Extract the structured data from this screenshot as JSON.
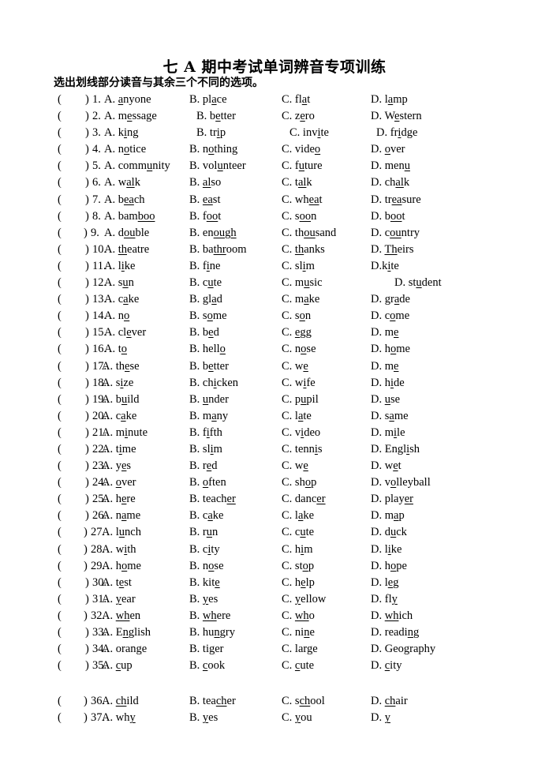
{
  "document": {
    "title": "七 A 期中考试单词辨音专项训练",
    "instruction": "选出划线部分读音与其余三个不同的选项。",
    "bracket_open": "(",
    "bracket_close": ")"
  },
  "questions": [
    {
      "num": "1.",
      "opts": [
        {
          "label": "A.",
          "pre": "",
          "u": "a",
          "post": "nyone"
        },
        {
          "label": "B.",
          "pre": "pl",
          "u": "a",
          "post": "ce"
        },
        {
          "label": "C.",
          "pre": "fl",
          "u": "a",
          "post": "t"
        },
        {
          "label": "D.",
          "pre": "l",
          "u": "a",
          "post": "mp"
        }
      ]
    },
    {
      "num": "2.",
      "indentB": true,
      "opts": [
        {
          "label": "A.",
          "pre": "m",
          "u": "e",
          "post": "ssage"
        },
        {
          "label": "B.",
          "pre": "b",
          "u": "e",
          "post": "tter"
        },
        {
          "label": "C.",
          "pre": "z",
          "u": "e",
          "post": "ro"
        },
        {
          "label": "D.",
          "pre": "W",
          "u": "e",
          "post": "stern"
        }
      ]
    },
    {
      "num": "3.",
      "indentB": true,
      "indentC": true,
      "indentD": true,
      "opts": [
        {
          "label": "A.",
          "pre": "k",
          "u": "i",
          "post": "ng"
        },
        {
          "label": "B.",
          "pre": "tr",
          "u": "i",
          "post": "p"
        },
        {
          "label": "C.",
          "pre": "inv",
          "u": "i",
          "post": "te"
        },
        {
          "label": "D.",
          "pre": "fr",
          "u": "i",
          "post": "dge"
        }
      ]
    },
    {
      "num": "4.",
      "opts": [
        {
          "label": "A.",
          "pre": "n",
          "u": "o",
          "post": "tice"
        },
        {
          "label": "B.",
          "pre": "n",
          "u": "o",
          "post": "thing"
        },
        {
          "label": "C.",
          "pre": "vide",
          "u": "o",
          "post": ""
        },
        {
          "label": "D.",
          "pre": "",
          "u": "o",
          "post": "ver"
        }
      ]
    },
    {
      "num": "5.",
      "opts": [
        {
          "label": "A.",
          "pre": "comm",
          "u": "u",
          "post": "nity"
        },
        {
          "label": "B.",
          "pre": "vol",
          "u": "u",
          "post": "nteer"
        },
        {
          "label": "C.",
          "pre": "f",
          "u": "u",
          "post": "ture"
        },
        {
          "label": "D.",
          "pre": "men",
          "u": "u",
          "post": ""
        }
      ]
    },
    {
      "num": "6.",
      "opts": [
        {
          "label": "A.",
          "pre": "w",
          "u": "al",
          "post": "k"
        },
        {
          "label": "B.",
          "pre": "",
          "u": "al",
          "post": "so"
        },
        {
          "label": "C.",
          "pre": "t",
          "u": "al",
          "post": "k"
        },
        {
          "label": "D.",
          "pre": "ch",
          "u": "al",
          "post": "k"
        }
      ]
    },
    {
      "num": "7.",
      "opts": [
        {
          "label": "A.",
          "pre": "b",
          "u": "ea",
          "post": "ch"
        },
        {
          "label": "B.",
          "pre": "",
          "u": "ea",
          "post": "st"
        },
        {
          "label": "C.",
          "pre": "wh",
          "u": "ea",
          "post": "t"
        },
        {
          "label": "D.",
          "pre": "tr",
          "u": "ea",
          "post": "sure"
        }
      ]
    },
    {
      "num": "8.",
      "opts": [
        {
          "label": "A.",
          "pre": "bam",
          "u": "boo",
          "post": ""
        },
        {
          "label": "B.",
          "pre": "f",
          "u": "oo",
          "post": "t"
        },
        {
          "label": "C.",
          "pre": "s",
          "u": "oo",
          "post": "n"
        },
        {
          "label": "D.",
          "pre": "b",
          "u": "oo",
          "post": "t"
        }
      ]
    },
    {
      "num": "9.",
      "tightNum": true,
      "opts": [
        {
          "label": "A.",
          "pre": "d",
          "u": "ou",
          "post": "ble"
        },
        {
          "label": "B.",
          "pre": "en",
          "u": "ough",
          "post": ""
        },
        {
          "label": "C.",
          "pre": "th",
          "u": "ou",
          "post": "sand"
        },
        {
          "label": "D.",
          "pre": "c",
          "u": "ou",
          "post": "ntry"
        }
      ]
    },
    {
      "num": "10.",
      "opts": [
        {
          "label": "A.",
          "pre": "",
          "u": "th",
          "post": "eatre"
        },
        {
          "label": "B.",
          "pre": "ba",
          "u": "thr",
          "post": "oom"
        },
        {
          "label": "C.",
          "pre": "",
          "u": "th",
          "post": "anks"
        },
        {
          "label": "D.",
          "pre": "",
          "u": "Th",
          "post": "eirs"
        }
      ]
    },
    {
      "num": "11.",
      "opts": [
        {
          "label": "A.",
          "pre": "l",
          "u": "i",
          "post": "ke"
        },
        {
          "label": "B.",
          "pre": "f",
          "u": "i",
          "post": "ne"
        },
        {
          "label": "C.",
          "pre": "sl",
          "u": "i",
          "post": "m"
        },
        {
          "label": "D.",
          "pre": "k",
          "u": "i",
          "post": "te",
          "nospace": true
        }
      ]
    },
    {
      "num": "12.",
      "indentD2": true,
      "opts": [
        {
          "label": "A.",
          "pre": "s",
          "u": "u",
          "post": "n"
        },
        {
          "label": "B.",
          "pre": "c",
          "u": "u",
          "post": "te"
        },
        {
          "label": "C.",
          "pre": "m",
          "u": "u",
          "post": "sic"
        },
        {
          "label": "D.",
          "pre": "st",
          "u": "u",
          "post": "dent"
        }
      ]
    },
    {
      "num": "13.",
      "opts": [
        {
          "label": "A.",
          "pre": "c",
          "u": "a",
          "post": "ke"
        },
        {
          "label": "B.",
          "pre": "gl",
          "u": "a",
          "post": "d"
        },
        {
          "label": "C.",
          "pre": "m",
          "u": "a",
          "post": "ke"
        },
        {
          "label": "D.",
          "pre": "gr",
          "u": "a",
          "post": "de"
        }
      ]
    },
    {
      "num": "14.",
      "opts": [
        {
          "label": "A.",
          "pre": "n",
          "u": "o",
          "post": ""
        },
        {
          "label": "B.",
          "pre": "s",
          "u": "o",
          "post": "me"
        },
        {
          "label": "C.",
          "pre": "s",
          "u": "o",
          "post": "n"
        },
        {
          "label": "D.",
          "pre": "c",
          "u": "o",
          "post": "me"
        }
      ]
    },
    {
      "num": "15.",
      "opts": [
        {
          "label": "A.",
          "pre": "cl",
          "u": "e",
          "post": "ver"
        },
        {
          "label": "B.",
          "pre": "b",
          "u": "e",
          "post": "d"
        },
        {
          "label": "C.",
          "pre": "",
          "u": "e",
          "post": "gg"
        },
        {
          "label": "D.",
          "pre": "m",
          "u": "e",
          "post": ""
        }
      ]
    },
    {
      "num": "16.",
      "opts": [
        {
          "label": "A.",
          "pre": "t",
          "u": "o",
          "post": ""
        },
        {
          "label": "B.",
          "pre": "hell",
          "u": "o",
          "post": ""
        },
        {
          "label": "C.",
          "pre": "n",
          "u": "o",
          "post": "se"
        },
        {
          "label": "D.",
          "pre": "h",
          "u": "o",
          "post": "me"
        }
      ]
    },
    {
      "num": "17.",
      "tightLabel": true,
      "opts": [
        {
          "label": "A.",
          "pre": "th",
          "u": "e",
          "post": "se"
        },
        {
          "label": "B.",
          "pre": "b",
          "u": "e",
          "post": "tter"
        },
        {
          "label": "C.",
          "pre": "w",
          "u": "e",
          "post": ""
        },
        {
          "label": "D.",
          "pre": "m",
          "u": "e",
          "post": ""
        }
      ]
    },
    {
      "num": "18.",
      "tightLabel": true,
      "opts": [
        {
          "label": "A.",
          "pre": "s",
          "u": "i",
          "post": "ze"
        },
        {
          "label": "B.",
          "pre": "ch",
          "u": "i",
          "post": "cken"
        },
        {
          "label": "C.",
          "pre": "w",
          "u": "i",
          "post": "fe"
        },
        {
          "label": "D.",
          "pre": "h",
          "u": "i",
          "post": "de"
        }
      ]
    },
    {
      "num": "19.",
      "tightLabel": true,
      "opts": [
        {
          "label": "A.",
          "pre": "b",
          "u": "u",
          "post": "ild"
        },
        {
          "label": "B.",
          "pre": "",
          "u": "u",
          "post": "nder"
        },
        {
          "label": "C.",
          "pre": "p",
          "u": "u",
          "post": "pil"
        },
        {
          "label": "D.",
          "pre": "",
          "u": "u",
          "post": "se"
        }
      ]
    },
    {
      "num": "20.",
      "tightLabel": true,
      "opts": [
        {
          "label": "A.",
          "pre": "c",
          "u": "a",
          "post": "ke"
        },
        {
          "label": "B.",
          "pre": "m",
          "u": "a",
          "post": "ny"
        },
        {
          "label": "C.",
          "pre": "l",
          "u": "a",
          "post": "te"
        },
        {
          "label": "D.",
          "pre": "s",
          "u": "a",
          "post": "me"
        }
      ]
    },
    {
      "num": "21.",
      "tightLabel": true,
      "opts": [
        {
          "label": "A.",
          "pre": "m",
          "u": "i",
          "post": "nute"
        },
        {
          "label": "B.",
          "pre": "f",
          "u": "i",
          "post": "fth"
        },
        {
          "label": "C.",
          "pre": "v",
          "u": "i",
          "post": "deo"
        },
        {
          "label": "D.",
          "pre": "m",
          "u": "i",
          "post": "le"
        }
      ]
    },
    {
      "num": "22.",
      "tightLabel": true,
      "opts": [
        {
          "label": "A.",
          "pre": "t",
          "u": "i",
          "post": "me"
        },
        {
          "label": "B.",
          "pre": "sl",
          "u": "i",
          "post": "m"
        },
        {
          "label": "C.",
          "pre": "tenn",
          "u": "i",
          "post": "s"
        },
        {
          "label": "D.",
          "pre": "Engl",
          "u": "i",
          "post": "sh"
        }
      ]
    },
    {
      "num": "23.",
      "tightLabel": true,
      "opts": [
        {
          "label": "A.",
          "pre": "y",
          "u": "e",
          "post": "s"
        },
        {
          "label": "B.",
          "pre": "r",
          "u": "e",
          "post": "d"
        },
        {
          "label": "C.",
          "pre": "w",
          "u": "e",
          "post": ""
        },
        {
          "label": "D.",
          "pre": "w",
          "u": "e",
          "post": "t"
        }
      ]
    },
    {
      "num": "24.",
      "tightLabel": true,
      "opts": [
        {
          "label": "A.",
          "pre": "",
          "u": "o",
          "post": "ver"
        },
        {
          "label": "B.",
          "pre": "",
          "u": "o",
          "post": "ften"
        },
        {
          "label": "C.",
          "pre": "sh",
          "u": "o",
          "post": "p"
        },
        {
          "label": "D.",
          "pre": "v",
          "u": "o",
          "post": "lleyball"
        }
      ]
    },
    {
      "num": "25.",
      "tightLabel": true,
      "opts": [
        {
          "label": "A.",
          "pre": "h",
          "u": "e",
          "post": "re"
        },
        {
          "label": "B.",
          "pre": "teach",
          "u": "er",
          "post": ""
        },
        {
          "label": "C.",
          "pre": "danc",
          "u": "er",
          "post": ""
        },
        {
          "label": "D.",
          "pre": "play",
          "u": "er",
          "post": ""
        }
      ]
    },
    {
      "num": "26.",
      "tightLabel": true,
      "opts": [
        {
          "label": "A.",
          "pre": "n",
          "u": "a",
          "post": "me"
        },
        {
          "label": "B.",
          "pre": "c",
          "u": "a",
          "post": "ke"
        },
        {
          "label": "C.",
          "pre": "l",
          "u": "a",
          "post": "ke"
        },
        {
          "label": "D.",
          "pre": "m",
          "u": "a",
          "post": "p"
        }
      ]
    },
    {
      "num": "27.",
      "tightLabel": true,
      "tightNum": true,
      "opts": [
        {
          "label": "A.",
          "pre": "l",
          "u": "u",
          "post": "nch"
        },
        {
          "label": "B.",
          "pre": "r",
          "u": "u",
          "post": "n"
        },
        {
          "label": "C.",
          "pre": "c",
          "u": "u",
          "post": "te"
        },
        {
          "label": "D.",
          "pre": "d",
          "u": "u",
          "post": "ck"
        }
      ]
    },
    {
      "num": "28.",
      "tightLabel": true,
      "tightNum": true,
      "opts": [
        {
          "label": "A.",
          "pre": "w",
          "u": "i",
          "post": "th"
        },
        {
          "label": "B.",
          "pre": "c",
          "u": "i",
          "post": "ty"
        },
        {
          "label": "C.",
          "pre": "h",
          "u": "i",
          "post": "m"
        },
        {
          "label": "D.",
          "pre": "l",
          "u": "i",
          "post": "ke"
        }
      ]
    },
    {
      "num": "29.",
      "tightLabel": true,
      "tightNum": true,
      "opts": [
        {
          "label": "A.",
          "pre": "h",
          "u": "o",
          "post": "me"
        },
        {
          "label": "B.",
          "pre": "n",
          "u": "o",
          "post": "se"
        },
        {
          "label": "C.",
          "pre": "st",
          "u": "o",
          "post": "p"
        },
        {
          "label": "D.",
          "pre": "h",
          "u": "o",
          "post": "pe"
        }
      ]
    },
    {
      "num": "30.",
      "tightLabel": true,
      "opts": [
        {
          "label": "A.",
          "pre": "t",
          "u": "e",
          "post": "st"
        },
        {
          "label": "B.",
          "pre": "kit",
          "u": "e",
          "post": ""
        },
        {
          "label": "C.",
          "pre": "h",
          "u": "e",
          "post": "lp"
        },
        {
          "label": "D.",
          "pre": "l",
          "u": "e",
          "post": "g"
        }
      ]
    },
    {
      "num": "31.",
      "tightLabel": true,
      "opts": [
        {
          "label": "A.",
          "pre": "",
          "u": "y",
          "post": "ear"
        },
        {
          "label": "B.",
          "pre": "",
          "u": "y",
          "post": "es"
        },
        {
          "label": "C.",
          "pre": "",
          "u": "y",
          "post": "ellow"
        },
        {
          "label": "D.",
          "pre": "fl",
          "u": "y",
          "post": ""
        }
      ]
    },
    {
      "num": "32.",
      "tightLabel": true,
      "tightNum": true,
      "opts": [
        {
          "label": "A.",
          "pre": "",
          "u": "wh",
          "post": "en"
        },
        {
          "label": "B.",
          "pre": "",
          "u": "wh",
          "post": "ere"
        },
        {
          "label": "C.",
          "pre": "",
          "u": "wh",
          "post": "o"
        },
        {
          "label": "D.",
          "pre": "",
          "u": "wh",
          "post": "ich"
        }
      ]
    },
    {
      "num": "33.",
      "tightLabel": true,
      "opts": [
        {
          "label": "A.",
          "pre": "E",
          "u": "n",
          "post": "glish"
        },
        {
          "label": "B.",
          "pre": "hu",
          "u": "n",
          "post": "gry"
        },
        {
          "label": "C.",
          "pre": "ni",
          "u": "n",
          "post": "e"
        },
        {
          "label": "D.",
          "pre": "readi",
          "u": "n",
          "post": "g"
        }
      ]
    },
    {
      "num": "34.",
      "tightLabel": true,
      "opts": [
        {
          "label": "A.",
          "pre": "oran",
          "u": "g",
          "post": "e"
        },
        {
          "label": "B.",
          "pre": "ti",
          "u": "g",
          "post": "er"
        },
        {
          "label": "C.",
          "pre": "lar",
          "u": "g",
          "post": "e"
        },
        {
          "label": "D.",
          "pre": "Geo",
          "u": "g",
          "post": "raphy"
        }
      ]
    },
    {
      "num": "35.",
      "tightLabel": true,
      "opts": [
        {
          "label": "A.",
          "pre": "",
          "u": "c",
          "post": "up"
        },
        {
          "label": "B.",
          "pre": "",
          "u": "c",
          "post": "ook"
        },
        {
          "label": "C.",
          "pre": "",
          "u": "c",
          "post": "ute"
        },
        {
          "label": "D.",
          "pre": "",
          "u": "c",
          "post": "ity"
        }
      ]
    },
    {
      "num": "36.",
      "tightLabel": true,
      "tightNum": true,
      "opts": [
        {
          "label": "A.",
          "pre": "",
          "u": "ch",
          "post": "ild"
        },
        {
          "label": "B.",
          "pre": "tea",
          "u": "ch",
          "post": "er"
        },
        {
          "label": "C.",
          "pre": "s",
          "u": "ch",
          "post": "ool"
        },
        {
          "label": "D.",
          "pre": "",
          "u": "ch",
          "post": "air"
        }
      ]
    },
    {
      "num": "37.",
      "tightLabel": true,
      "tightNum": true,
      "opts": [
        {
          "label": "A.",
          "pre": "wh",
          "u": "y",
          "post": ""
        },
        {
          "label": "B.",
          "pre": "",
          "u": "y",
          "post": "es"
        },
        {
          "label": "C.",
          "pre": "",
          "u": "y",
          "post": "ou"
        },
        {
          "label": "D.",
          "pre": "",
          "u": "y",
          "post": ""
        }
      ]
    }
  ]
}
